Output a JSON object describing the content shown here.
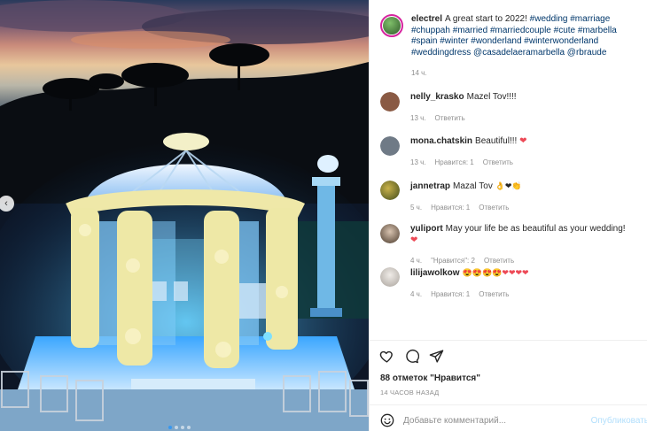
{
  "photo": {
    "prev_glyph": "‹",
    "dots_count": 4,
    "active_dot": 0
  },
  "caption": {
    "username": "electrel",
    "text": "A great start to 2022! ",
    "hashtags": "#wedding #marriage #chuppah #married #marriedcouple #cute #marbella #spain #winter #wonderland #winterwonderland #weddingdress @casadelaeramarbella @rbraude",
    "time": "14 ч."
  },
  "comments": [
    {
      "username": "nelly_krasko",
      "text": "Mazel Tov!!!!",
      "emoji": "",
      "time": "13 ч.",
      "likes": "",
      "reply": "Ответить",
      "avatar_color": "#8a5a44"
    },
    {
      "username": "mona.chatskin",
      "text": "Beautiful!!! ",
      "emoji": "❤",
      "time": "13 ч.",
      "likes": "Нравится: 1",
      "reply": "Ответить",
      "avatar_color": "#6f7a86"
    },
    {
      "username": "jannetrap",
      "text": "Mazal Tov ",
      "emoji": "👌❤👏",
      "time": "5 ч.",
      "likes": "Нравится: 1",
      "reply": "Ответить",
      "avatar_color": "#6b7a2a"
    },
    {
      "username": "yuliport",
      "text": "May your life be as beautiful as your wedding! ",
      "emoji": "❤",
      "time": "4 ч.",
      "likes": "\"Нравится\": 2",
      "reply": "Ответить",
      "avatar_color": "#5a4a3c"
    },
    {
      "username": "lilijawolkow",
      "text": "",
      "emoji": "😍😍😍😍❤❤❤❤",
      "time": "4 ч.",
      "likes": "Нравится: 1",
      "reply": "Ответить",
      "avatar_color": "#c9c4c0"
    }
  ],
  "footer": {
    "likes_count": "88 отметок \"Нравится\"",
    "date": "14 ЧАСОВ НАЗАД",
    "comment_placeholder": "Добавьте комментарий...",
    "publish_label": "Опубликовать"
  },
  "colors": {
    "link": "#00376b",
    "muted": "#8e8e8e",
    "heart": "#ed4956",
    "publish": "#b2dffc",
    "active_dot": "#3897f0"
  },
  "icons": [
    "heart-icon",
    "comment-icon",
    "share-icon",
    "emoji-icon",
    "chevron-left-icon"
  ]
}
